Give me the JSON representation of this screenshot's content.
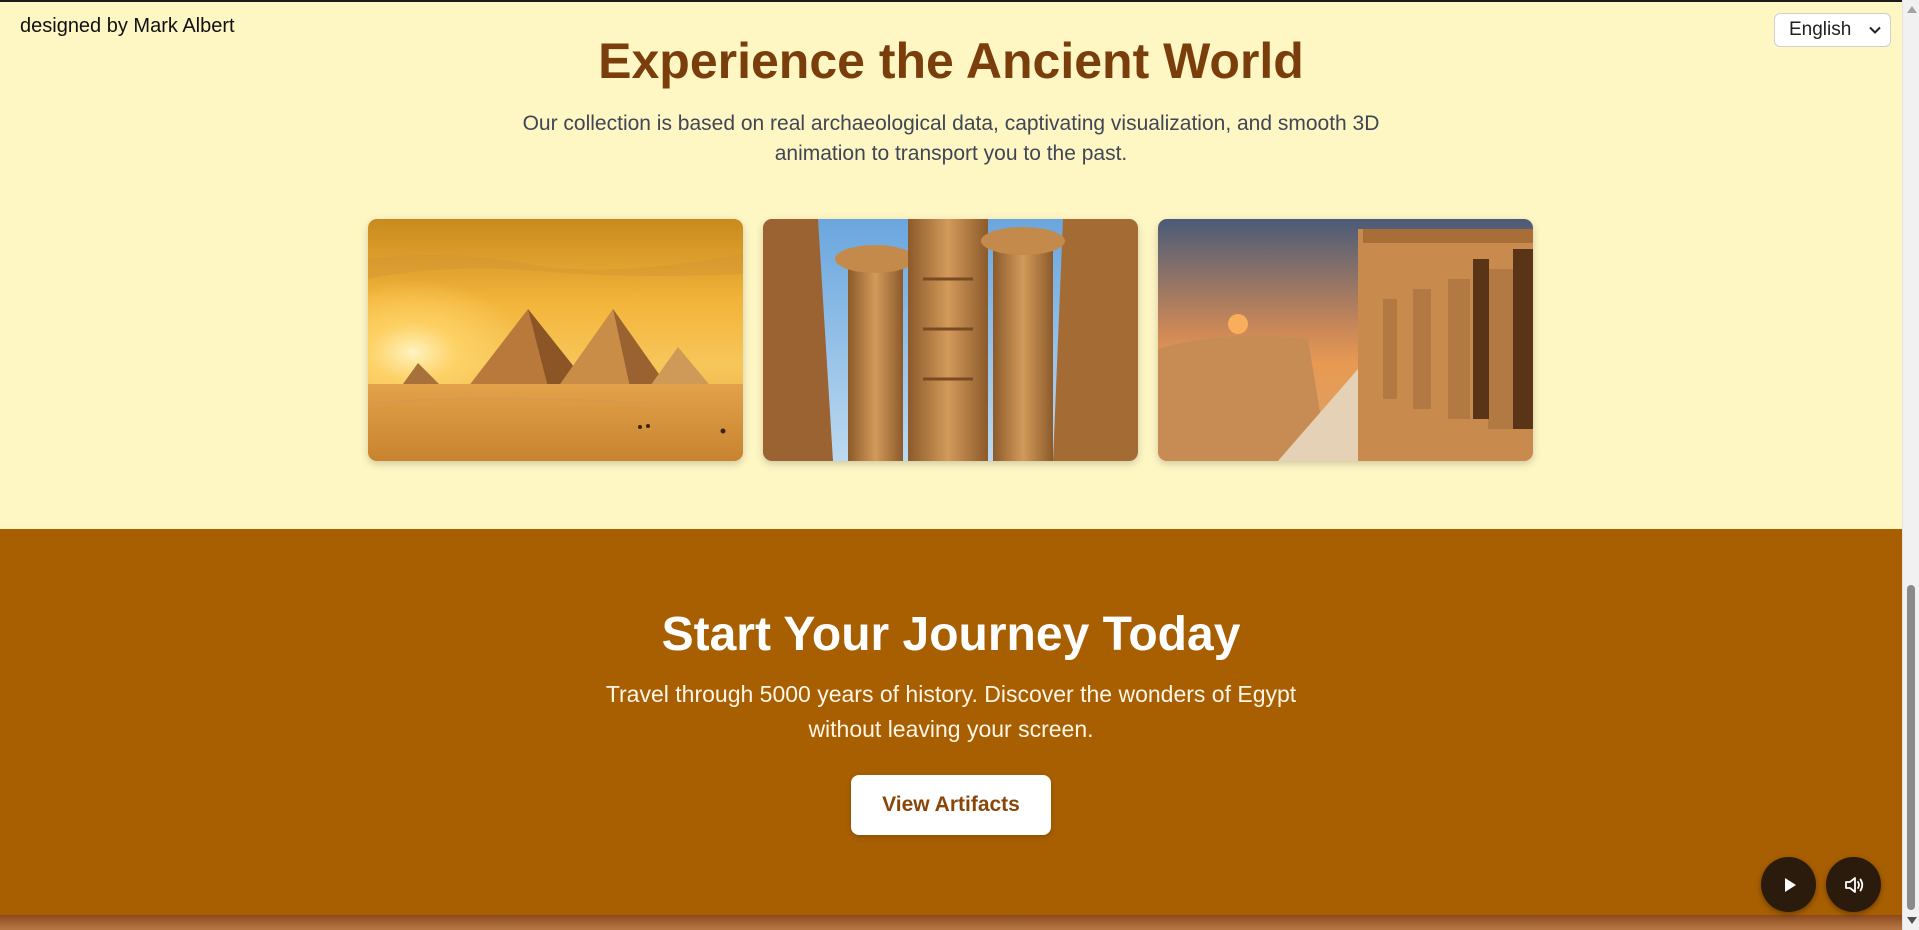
{
  "header": {
    "credit": "designed by Mark Albert",
    "language": {
      "selected": "English"
    }
  },
  "hero": {
    "title": "Experience the Ancient World",
    "subtitle": "Our collection is based on real archaeological data, captivating visualization, and smooth 3D animation to transport you to the past."
  },
  "gallery": {
    "images": [
      {
        "subject": "pyramids-at-sunset"
      },
      {
        "subject": "temple-columns"
      },
      {
        "subject": "temple-colonnade-statues"
      }
    ]
  },
  "journey": {
    "title": "Start Your Journey Today",
    "subtitle": "Travel through 5000 years of history. Discover the wonders of Egypt without leaving your screen.",
    "cta_label": "View Artifacts"
  },
  "media_controls": {
    "play_icon": "play-icon",
    "volume_icon": "volume-icon"
  },
  "colors": {
    "top_background": "#fef6c3",
    "title": "#7a3e0c",
    "journey_background": "#a85f02",
    "cta_text": "#8a4608",
    "fab_background": "#2a1b0d"
  }
}
